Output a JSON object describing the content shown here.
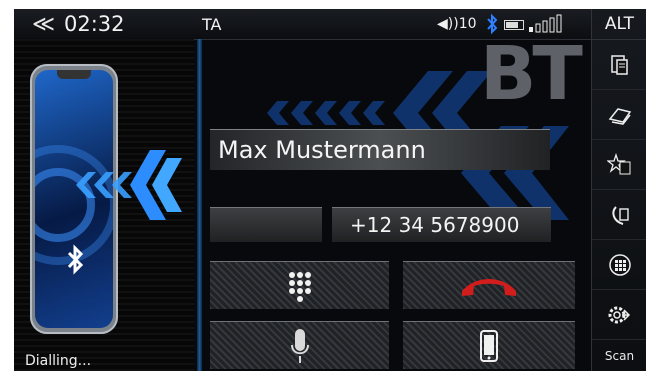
{
  "status_bar": {
    "back_symbol": "≪",
    "clock": "02:32",
    "ta_label": "TA",
    "volume_label": "◀))10"
  },
  "sidebar": {
    "alt_label": "ALT",
    "scan_label": "Scan"
  },
  "call": {
    "contact_name": "Max Mustermann",
    "phone_number": "+12 34 5678900",
    "status": "Dialling..."
  },
  "brand_mark": "BT",
  "icons": [
    "phonebook-icon",
    "contacts-book-icon",
    "favorites-icon",
    "recent-calls-icon",
    "keypad-icon",
    "settings-icon",
    "end-call-icon",
    "microphone-icon",
    "mobile-phone-icon",
    "bluetooth-icon"
  ],
  "colors": {
    "accent_blue": "#1f6fd0",
    "end_call_red": "#d21d1d",
    "background": "#07090c"
  }
}
